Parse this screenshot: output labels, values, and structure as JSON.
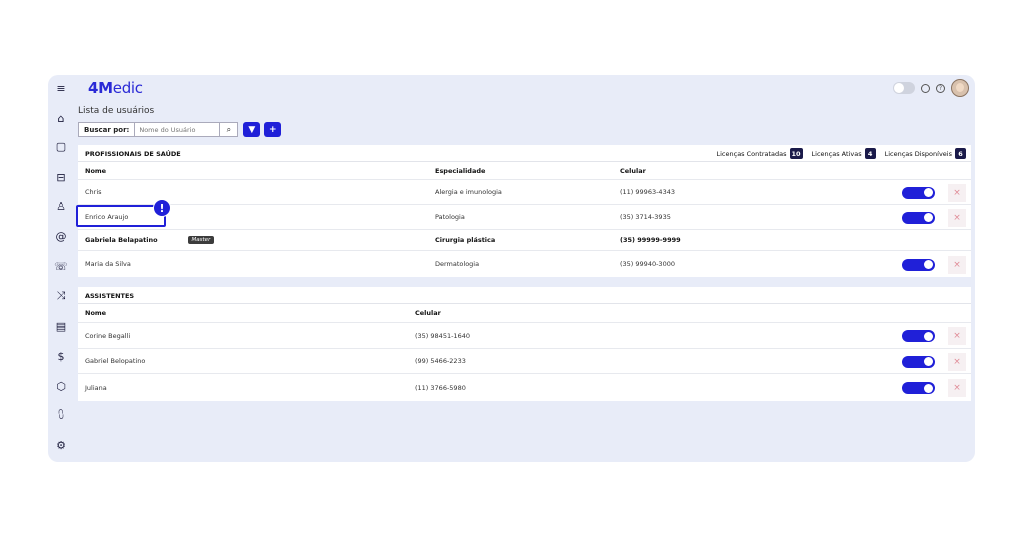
{
  "app": {
    "logo_bold": "4M",
    "logo_rest": "edic"
  },
  "sidebar": {
    "items": [
      {
        "icon": "menu-icon",
        "glyph": "≡"
      },
      {
        "icon": "home-icon",
        "glyph": "⌂"
      },
      {
        "icon": "calendar-icon",
        "glyph": "▢"
      },
      {
        "icon": "car-icon",
        "glyph": "⊟"
      },
      {
        "icon": "user-icon",
        "glyph": "♙"
      },
      {
        "icon": "at-icon",
        "glyph": "@"
      },
      {
        "icon": "phone-icon",
        "glyph": "☏"
      },
      {
        "icon": "shuffle-icon",
        "glyph": "⤨"
      },
      {
        "icon": "clipboard-icon",
        "glyph": "▤"
      },
      {
        "icon": "dollar-icon",
        "glyph": "$"
      },
      {
        "icon": "box-icon",
        "glyph": "⬡"
      },
      {
        "icon": "chart-icon",
        "glyph": "⩇"
      },
      {
        "icon": "gear-icon",
        "glyph": "⚙"
      }
    ]
  },
  "page": {
    "title": "Lista de usuários"
  },
  "search": {
    "label": "Buscar por:",
    "placeholder": "Nome do Usuário",
    "search_glyph": "⌕",
    "filter_glyph": "▼",
    "add_glyph": "+"
  },
  "professionals": {
    "title": "PROFISSIONAIS DE SAÚDE",
    "licenses": [
      {
        "label": "Licenças Contratadas",
        "value": "10"
      },
      {
        "label": "Licenças Ativas",
        "value": "4"
      },
      {
        "label": "Licenças Disponíveis",
        "value": "6"
      }
    ],
    "columns": {
      "name": "Nome",
      "specialty": "Especialidade",
      "phone": "Celular"
    },
    "rows": [
      {
        "name": "Chris",
        "specialty": "Alergia e imunologia",
        "phone": "(11) 99963-4343"
      },
      {
        "name": "Enrico Araujo",
        "specialty": "Patologia",
        "phone": "(35) 3714-3935"
      },
      {
        "name": "Gabriela Belapatino",
        "badge": "Master",
        "specialty": "Cirurgia plástica",
        "phone": "(35) 99999-9999"
      },
      {
        "name": "Maria da Silva",
        "specialty": "Dermatologia",
        "phone": "(35) 99940-3000"
      }
    ]
  },
  "assistants": {
    "title": "ASSISTENTES",
    "columns": {
      "name": "Nome",
      "phone": "Celular"
    },
    "rows": [
      {
        "name": "Corine Begalli",
        "phone": "(35) 98451-1640"
      },
      {
        "name": "Gabriel Belopatino",
        "phone": "(99) 5466-2233"
      },
      {
        "name": "Juliana",
        "phone": "(11) 3766-5980"
      }
    ]
  },
  "actions": {
    "delete_glyph": "×",
    "alert_glyph": "!"
  },
  "colors": {
    "accent": "#2020d8",
    "background": "#e8ecf8"
  }
}
